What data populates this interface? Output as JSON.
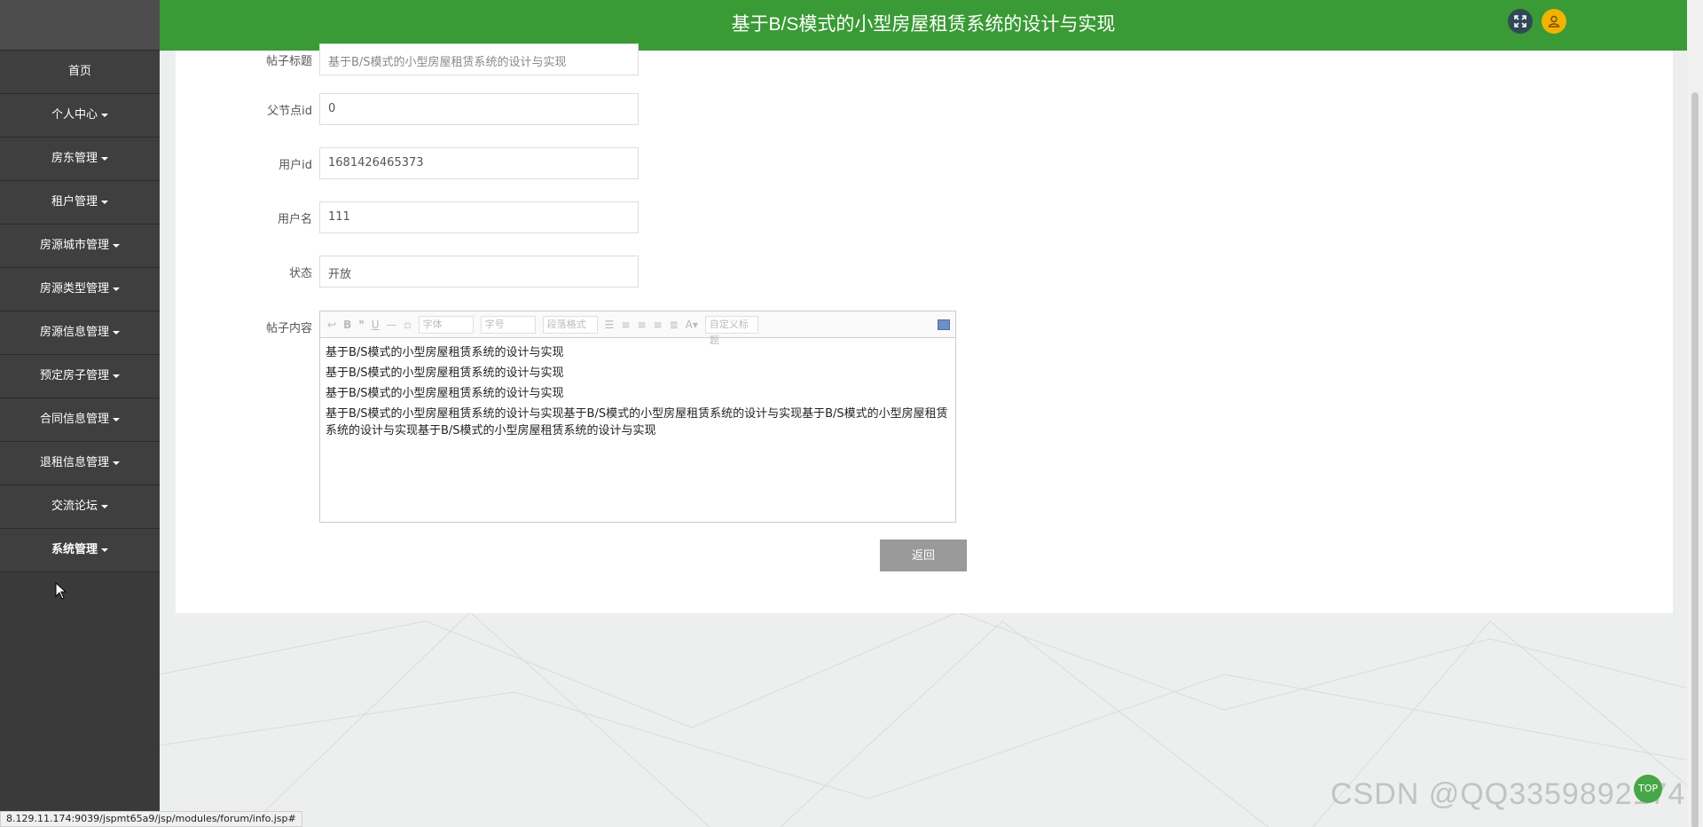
{
  "header": {
    "title": "基于B/S模式的小型房屋租赁系统的设计与实现",
    "fullscreen_icon": "expand-arrows-icon",
    "avatar_icon": "user-icon"
  },
  "sidebar": {
    "items": [
      {
        "label": "首页",
        "has_caret": false
      },
      {
        "label": "个人中心",
        "has_caret": true
      },
      {
        "label": "房东管理",
        "has_caret": true
      },
      {
        "label": "租户管理",
        "has_caret": true
      },
      {
        "label": "房源城市管理",
        "has_caret": true
      },
      {
        "label": "房源类型管理",
        "has_caret": true
      },
      {
        "label": "房源信息管理",
        "has_caret": true
      },
      {
        "label": "预定房子管理",
        "has_caret": true
      },
      {
        "label": "合同信息管理",
        "has_caret": true
      },
      {
        "label": "退租信息管理",
        "has_caret": true
      },
      {
        "label": "交流论坛",
        "has_caret": true
      },
      {
        "label": "系统管理",
        "has_caret": true
      }
    ]
  },
  "form": {
    "title_label": "帖子标题",
    "title_value": "基于B/S模式的小型房屋租赁系统的设计与实现",
    "parent_label": "父节点id",
    "parent_value": "0",
    "userid_label": "用户id",
    "userid_value": "1681426465373",
    "username_label": "用户名",
    "username_value": "111",
    "status_label": "状态",
    "status_value": "开放",
    "content_label": "帖子内容"
  },
  "editor": {
    "toolbar": {
      "font_placeholder": "字体",
      "size_placeholder": "字号",
      "paragraph_placeholder": "段落格式",
      "custom_title_placeholder": "自定义标题"
    },
    "paragraphs": [
      "基于B/S模式的小型房屋租赁系统的设计与实现",
      "基于B/S模式的小型房屋租赁系统的设计与实现",
      "基于B/S模式的小型房屋租赁系统的设计与实现",
      "基于B/S模式的小型房屋租赁系统的设计与实现基于B/S模式的小型房屋租赁系统的设计与实现基于B/S模式的小型房屋租赁系统的设计与实现基于B/S模式的小型房屋租赁系统的设计与实现"
    ]
  },
  "buttons": {
    "back_label": "返回",
    "top_label": "TOP"
  },
  "statusbar": {
    "url": "8.129.11.174:9039/jspmt65a9/jsp/modules/forum/info.jsp#"
  },
  "watermark": {
    "text": "CSDN @QQ3359892174"
  },
  "colors": {
    "header_bg": "#3a9a35",
    "sidebar_bg": "#3f3f3f",
    "button_bg": "#9a9a9a"
  }
}
